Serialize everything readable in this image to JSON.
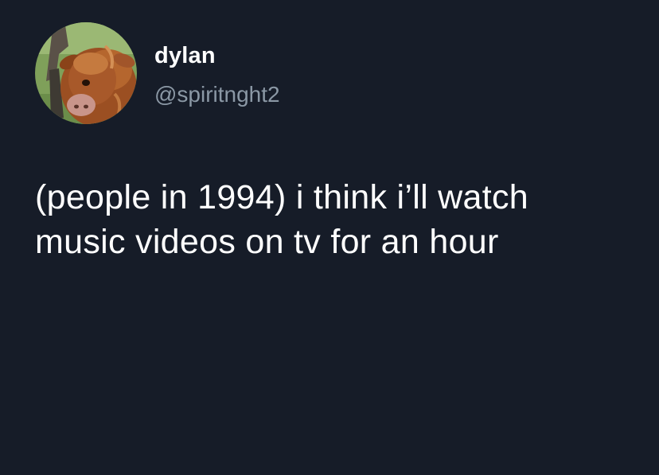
{
  "tweet": {
    "author": {
      "display_name": "dylan",
      "handle": "@spiritnght2",
      "avatar": "highland-calf-avatar"
    },
    "text_lines": [
      "(people in 1994) i think i’ll watch",
      "music videos on tv for an hour"
    ]
  },
  "colors": {
    "background": "#161c28",
    "primary_text": "#ffffff",
    "secondary_text": "#8b98a5"
  }
}
